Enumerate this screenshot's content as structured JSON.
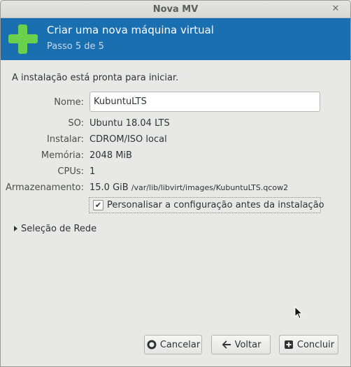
{
  "window": {
    "title": "Nova MV",
    "close_glyph": "✕"
  },
  "banner": {
    "title": "Criar uma nova máquina virtual",
    "step": "Passo 5 de 5",
    "icon": "plus-icon",
    "accent_color": "#1a6fb1",
    "icon_color": "#6bd14c"
  },
  "main": {
    "ready_text": "A instalação está pronta para iniciar.",
    "name": {
      "label": "Nome:",
      "value": "KubuntuLTS"
    },
    "os": {
      "label": "SO:",
      "value": "Ubuntu 18.04 LTS"
    },
    "install": {
      "label": "Instalar:",
      "value": "CDROM/ISO local"
    },
    "memory": {
      "label": "Memória:",
      "value": "2048 MiB"
    },
    "cpus": {
      "label": "CPUs:",
      "value": "1"
    },
    "storage": {
      "label": "Armazenamento:",
      "size": "15.0 GiB",
      "path": "/var/lib/libvirt/images/KubuntuLTS.qcow2"
    },
    "customize": {
      "label": "Personalisar a configuração antes da instalação",
      "checked": true,
      "check_glyph": "✔"
    },
    "network_expander": {
      "label": "Seleção de Rede",
      "expanded": false
    }
  },
  "buttons": {
    "cancel": {
      "label": "Cancelar",
      "icon": "cancel-icon"
    },
    "back": {
      "label": "Voltar",
      "icon": "back-arrow-icon"
    },
    "finish": {
      "label": "Concluir",
      "icon": "add-box-icon"
    }
  }
}
